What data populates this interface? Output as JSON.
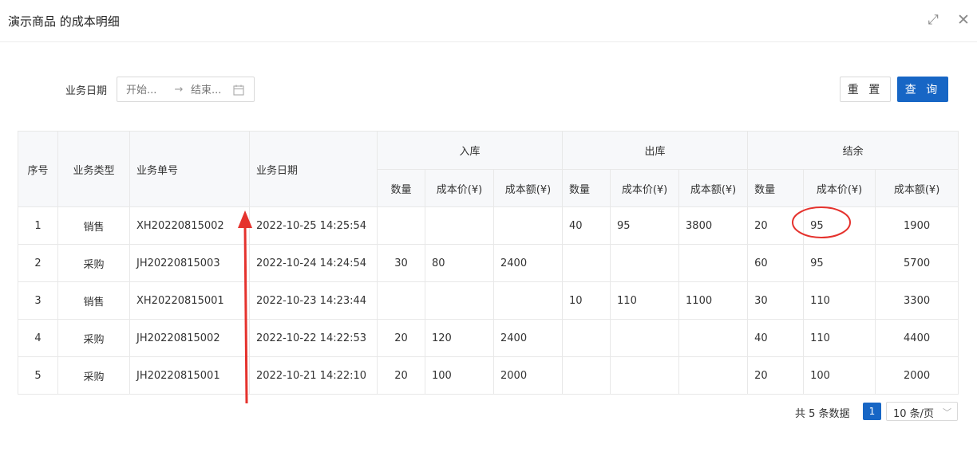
{
  "header": {
    "title": "演示商品 的成本明细",
    "maximize_icon": "maximize-icon",
    "close_icon": "close-icon"
  },
  "filter": {
    "label": "业务日期",
    "start_placeholder": "开始...",
    "arrow": "→",
    "end_placeholder": "结束...",
    "calendar_icon": "calendar-icon"
  },
  "buttons": {
    "reset": "重 置",
    "query": "查 询"
  },
  "table": {
    "headers": {
      "seq": "序号",
      "type": "业务类型",
      "order": "业务单号",
      "date": "业务日期",
      "in": "入库",
      "out": "出库",
      "balance": "结余"
    },
    "sub": {
      "qty": "数量",
      "price": "成本价(¥)",
      "amount": "成本额(¥)"
    },
    "rows": [
      {
        "seq": "1",
        "type": "销售",
        "order": "XH20220815002",
        "date": "2022-10-25 14:25:54",
        "in_qty": "",
        "in_price": "",
        "in_amount": "",
        "out_qty": "40",
        "out_price": "95",
        "out_amount": "3800",
        "bal_qty": "20",
        "bal_price": "95",
        "bal_amount": "1900"
      },
      {
        "seq": "2",
        "type": "采购",
        "order": "JH20220815003",
        "date": "2022-10-24 14:24:54",
        "in_qty": "30",
        "in_price": "80",
        "in_amount": "2400",
        "out_qty": "",
        "out_price": "",
        "out_amount": "",
        "bal_qty": "60",
        "bal_price": "95",
        "bal_amount": "5700"
      },
      {
        "seq": "3",
        "type": "销售",
        "order": "XH20220815001",
        "date": "2022-10-23 14:23:44",
        "in_qty": "",
        "in_price": "",
        "in_amount": "",
        "out_qty": "10",
        "out_price": "110",
        "out_amount": "1100",
        "bal_qty": "30",
        "bal_price": "110",
        "bal_amount": "3300"
      },
      {
        "seq": "4",
        "type": "采购",
        "order": "JH20220815002",
        "date": "2022-10-22 14:22:53",
        "in_qty": "20",
        "in_price": "120",
        "in_amount": "2400",
        "out_qty": "",
        "out_price": "",
        "out_amount": "",
        "bal_qty": "40",
        "bal_price": "110",
        "bal_amount": "4400"
      },
      {
        "seq": "5",
        "type": "采购",
        "order": "JH20220815001",
        "date": "2022-10-21 14:22:10",
        "in_qty": "20",
        "in_price": "100",
        "in_amount": "2000",
        "out_qty": "",
        "out_price": "",
        "out_amount": "",
        "bal_qty": "20",
        "bal_price": "100",
        "bal_amount": "2000"
      }
    ]
  },
  "pagination": {
    "total": "共 5 条数据",
    "current": "1",
    "page_size": "10 条/页",
    "chevron_icon": "chevron-down-icon"
  },
  "colors": {
    "primary": "#1766c5",
    "annotation": "#e5322d",
    "border": "#e8e8e8",
    "header_bg": "#f7f8fa"
  }
}
